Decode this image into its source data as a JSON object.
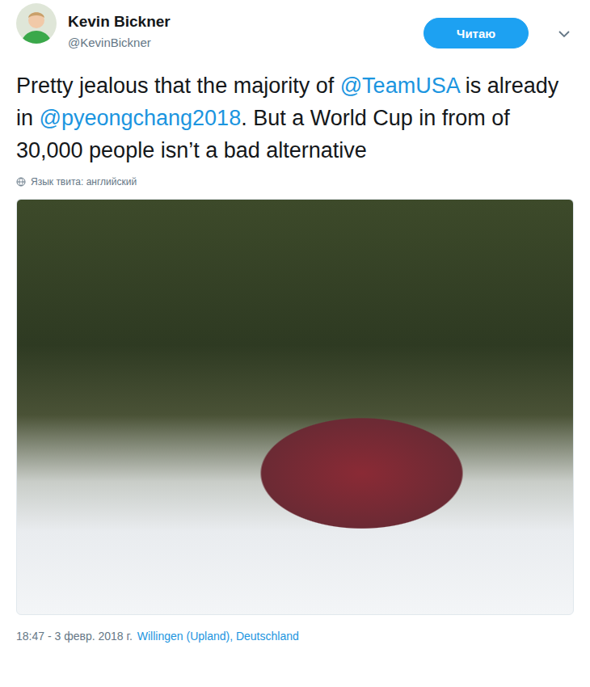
{
  "author": {
    "name": "Kevin Bickner",
    "handle": "@KevinBickner"
  },
  "follow_button": {
    "label": "Читаю",
    "selected": true
  },
  "tweet": {
    "segments": [
      {
        "text": "Pretty jealous that the majority of ",
        "kind": "plain"
      },
      {
        "text": "@TeamUSA",
        "kind": "mention"
      },
      {
        "text": " is already in ",
        "kind": "plain"
      },
      {
        "text": "@pyeongchang2018",
        "kind": "mention"
      },
      {
        "text": ". But a World Cup in from of 30,000 people isn’t a bad alternative",
        "kind": "plain"
      }
    ]
  },
  "language_note": "Язык твита: английский",
  "media": {
    "kind": "photo"
  },
  "footer": {
    "timestamp": "18:47 - 3 февр. 2018 г.",
    "location": "Willingen (Upland), Deutschland"
  }
}
